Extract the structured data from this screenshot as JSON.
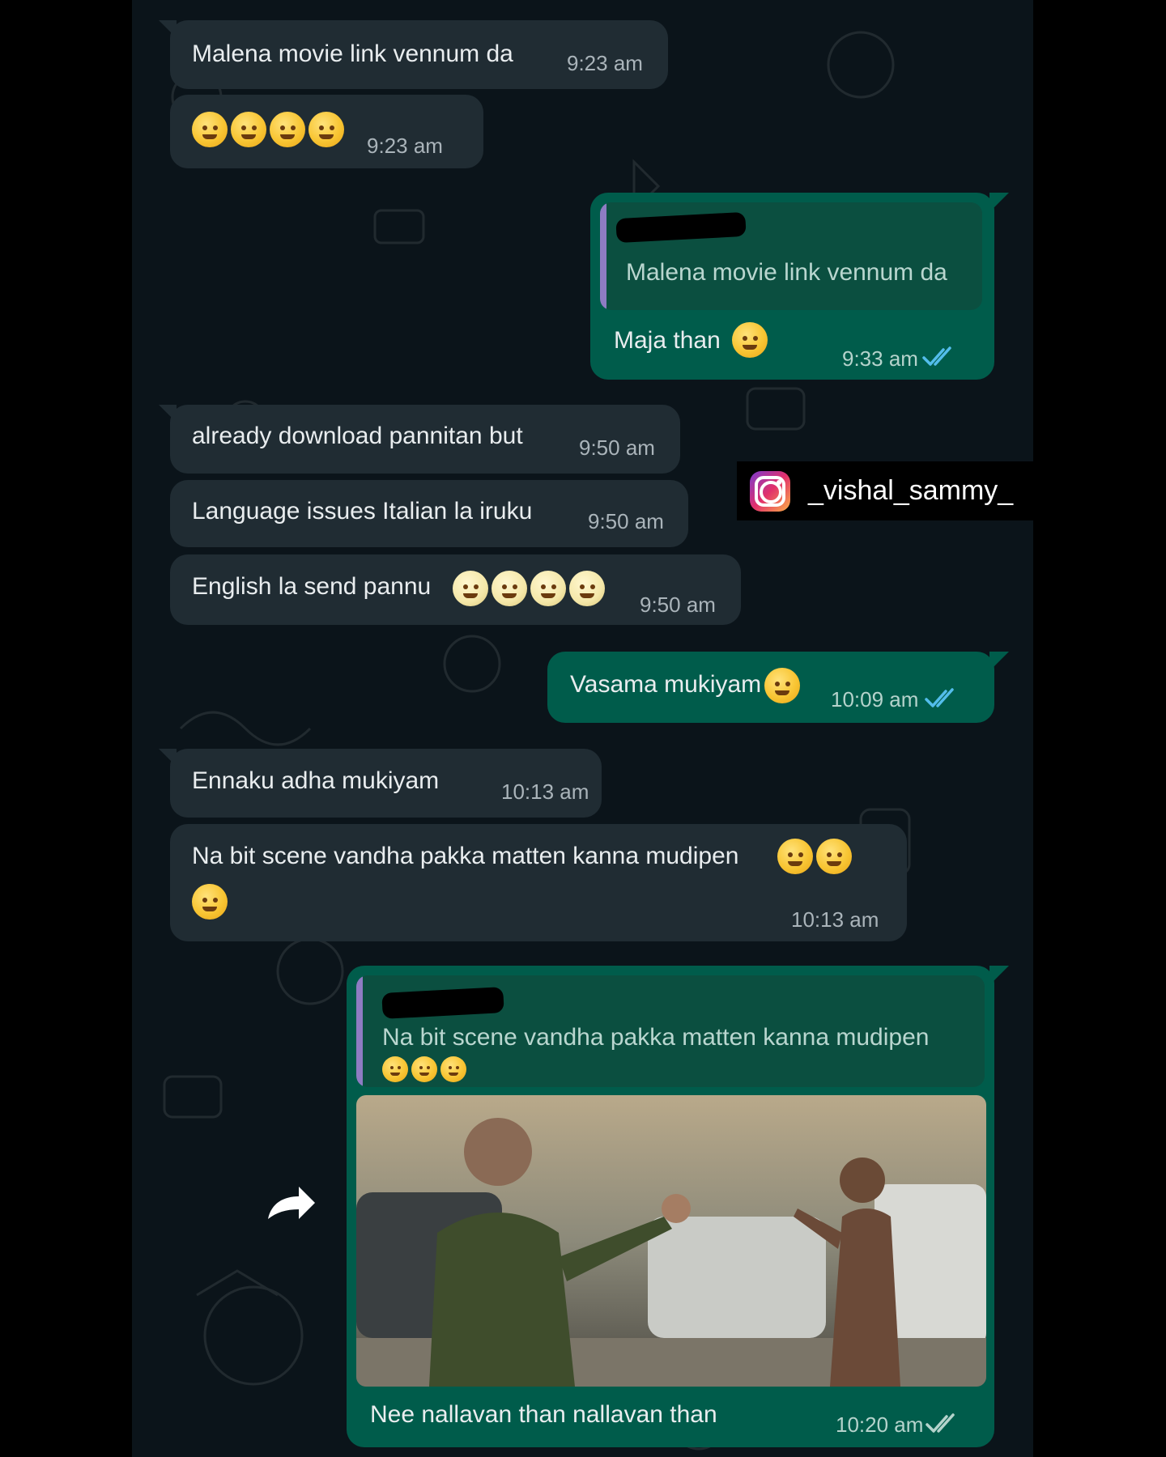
{
  "messages": [
    {
      "text": "Malena movie link vennum da",
      "time": "9:23 am"
    },
    {
      "time": "9:23 am"
    },
    {
      "quote_text": "Malena movie link vennum da",
      "text": "Maja than",
      "time": "9:33 am"
    },
    {
      "text": "already download pannitan but",
      "time": "9:50 am"
    },
    {
      "text": "Language issues Italian la iruku",
      "time": "9:50 am"
    },
    {
      "text": "English la send pannu",
      "time": "9:50 am"
    },
    {
      "text": "Vasama mukiyam",
      "time": "10:09 am"
    },
    {
      "text": "Ennaku adha mukiyam",
      "time": "10:13 am"
    },
    {
      "text": "Na bit scene vandha pakka matten kanna mudipen",
      "time": "10:13 am"
    },
    {
      "quote_text": "Na bit scene vandha pakka matten kanna mudipen",
      "caption": "Nee nallavan than nallavan than",
      "time": "10:20 am"
    }
  ],
  "overlay": {
    "instagram_handle": "_vishal_sammy_"
  },
  "icons": {
    "read_receipt": "double-check-icon",
    "forward": "forward-arrow-icon",
    "watermark": "instagram-logo-icon"
  },
  "colors": {
    "background": "#0b141a",
    "incoming_bubble": "#202c33",
    "outgoing_bubble": "#005c4b",
    "read_tick": "#53bdeb",
    "quote_bar": "#8e7cc3"
  }
}
